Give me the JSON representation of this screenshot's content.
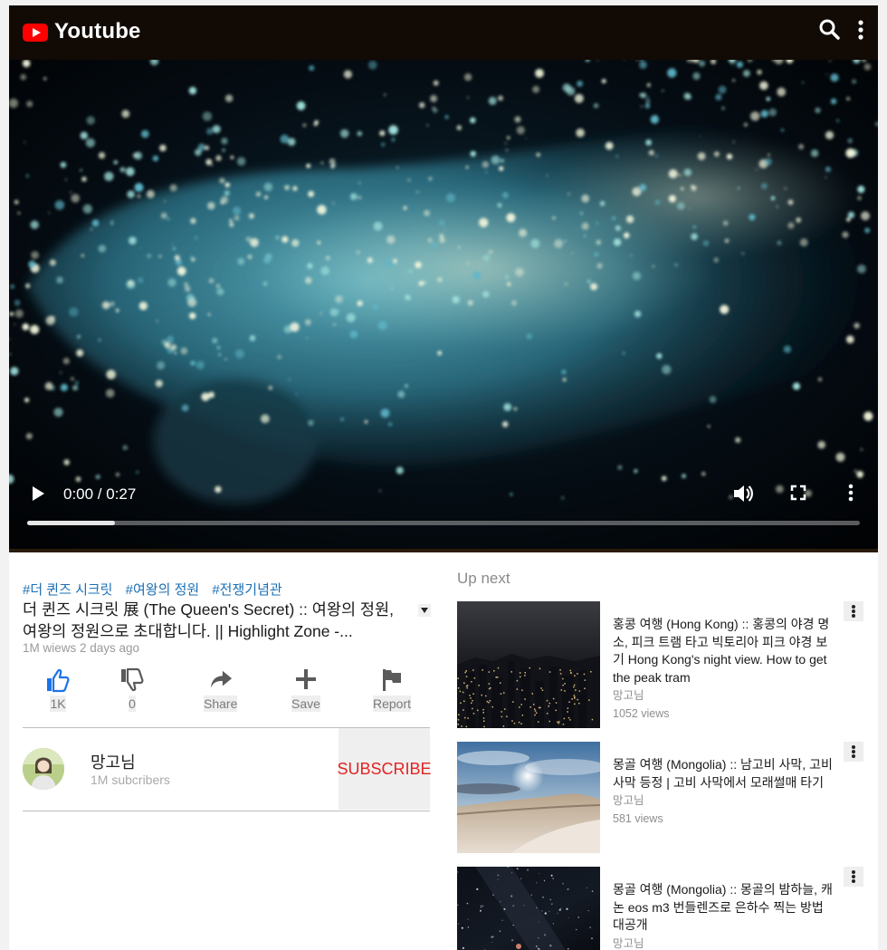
{
  "header": {
    "brand": "Youtube",
    "icons": [
      "youtube-logo-icon",
      "search-icon",
      "more-vert-icon"
    ]
  },
  "player": {
    "time": "0:00 / 0:27",
    "progress_fraction": 0.105,
    "controls": [
      "play-icon",
      "volume-icon",
      "fullscreen-icon",
      "more-vert-icon"
    ]
  },
  "video": {
    "tags": [
      "#더 퀸즈 시크릿",
      "#여왕의 정원",
      "#전쟁기념관"
    ],
    "title": "더 퀸즈 시크릿 展 (The Queen's Secret) :: 여왕의 정원, 여왕의 정원으로 초대합니다. || Highlight Zone -...",
    "meta": "1M wiews 2 days ago"
  },
  "actions": {
    "like": "1K",
    "dislike": "0",
    "share": "Share",
    "save": "Save",
    "report": "Report"
  },
  "channel": {
    "name": "망고님",
    "subscribers": "1M subcribers",
    "subscribe_label": "SUBSCRIBE"
  },
  "upnext": {
    "title": "Up next",
    "items": [
      {
        "title": "홍콩 여행 (Hong Kong) :: 홍콩의 야경 명소, 피크 트램 타고 빅토리아 피크 야경 보기 Hong Kong's night view. How to get the peak tram",
        "channel": "망고님",
        "views": "1052 views"
      },
      {
        "title": "몽골 여행 (Mongolia) :: 남고비 사막, 고비 사막 등정 | 고비 사막에서 모래썰매 타기",
        "channel": "망고님",
        "views": "581 views"
      },
      {
        "title": "몽골 여행 (Mongolia) :: 몽골의 밤하늘, 캐논 eos m3 번들렌즈로 은하수 찍는 방법 대공개",
        "channel": "망고님",
        "views": ""
      }
    ]
  },
  "colors": {
    "header_bg": "#120a04",
    "brand_red": "#ff0000",
    "tag_link": "#1a6fb5",
    "subscribe_text": "#e32222",
    "like_blue": "#1a73e8"
  }
}
